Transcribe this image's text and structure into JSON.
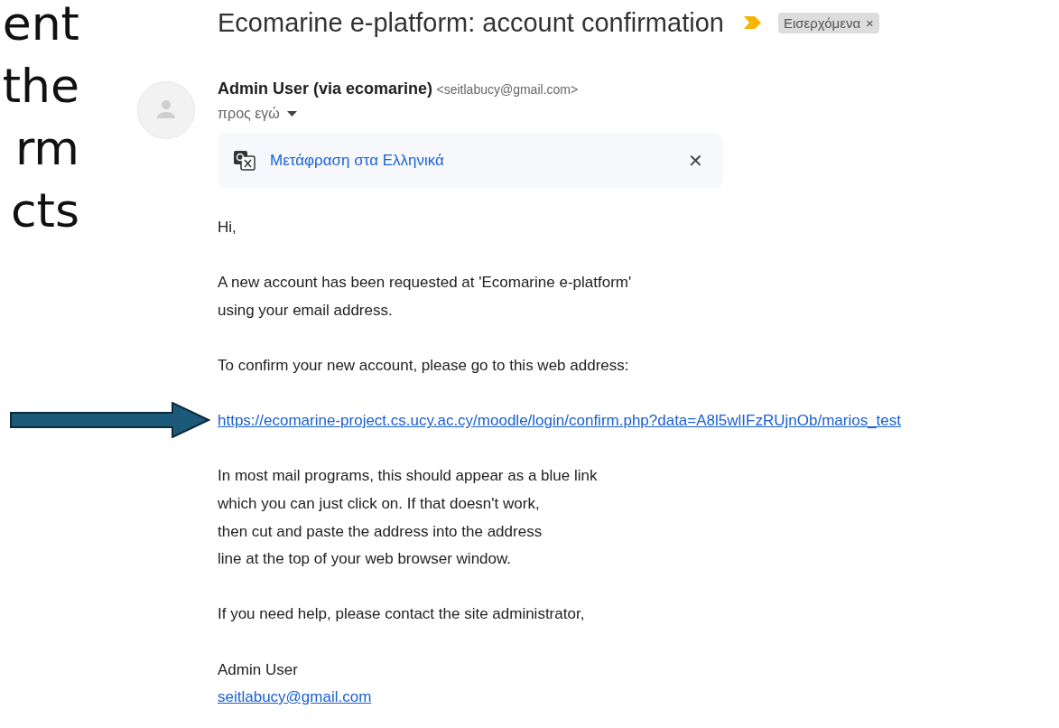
{
  "slide_text": [
    "ent",
    "the",
    "rm",
    "cts"
  ],
  "email": {
    "subject": "Ecomarine e-platform: account confirmation",
    "important": true,
    "label": {
      "text": "Εισερχόμενα",
      "remove": "×"
    },
    "sender": {
      "name": "Admin User (via ecomarine)",
      "address": "<seitlabucy@gmail.com>",
      "recipient": "προς εγώ"
    },
    "translate_bar": {
      "link": "Μετάφραση στα Ελληνικά",
      "close": "✕"
    },
    "body": [
      {
        "kind": "paragraph",
        "lines": [
          "Hi,"
        ]
      },
      {
        "kind": "paragraph",
        "lines": [
          "A new account has been requested at 'Ecomarine e-platform'",
          "using your email address."
        ]
      },
      {
        "kind": "paragraph",
        "lines": [
          "To confirm your new account, please go to this web address:"
        ]
      },
      {
        "kind": "link",
        "text": "https://ecomarine-project.cs.ucy.ac.cy/moodle/login/confirm.php?data=A8l5wlIFzRUjnOb/marios_test",
        "pointer_arrow": true
      },
      {
        "kind": "paragraph",
        "lines": [
          "In most mail programs, this should appear as a blue link",
          "which you can just click on. If that doesn't work,",
          "then cut and paste the address into the address",
          "line at the top of your web browser window."
        ]
      },
      {
        "kind": "paragraph",
        "lines": [
          "If you need help, please contact the site administrator,"
        ]
      },
      {
        "kind": "signature",
        "name": "Admin User",
        "email": "seitlabucy@gmail.com"
      }
    ]
  }
}
